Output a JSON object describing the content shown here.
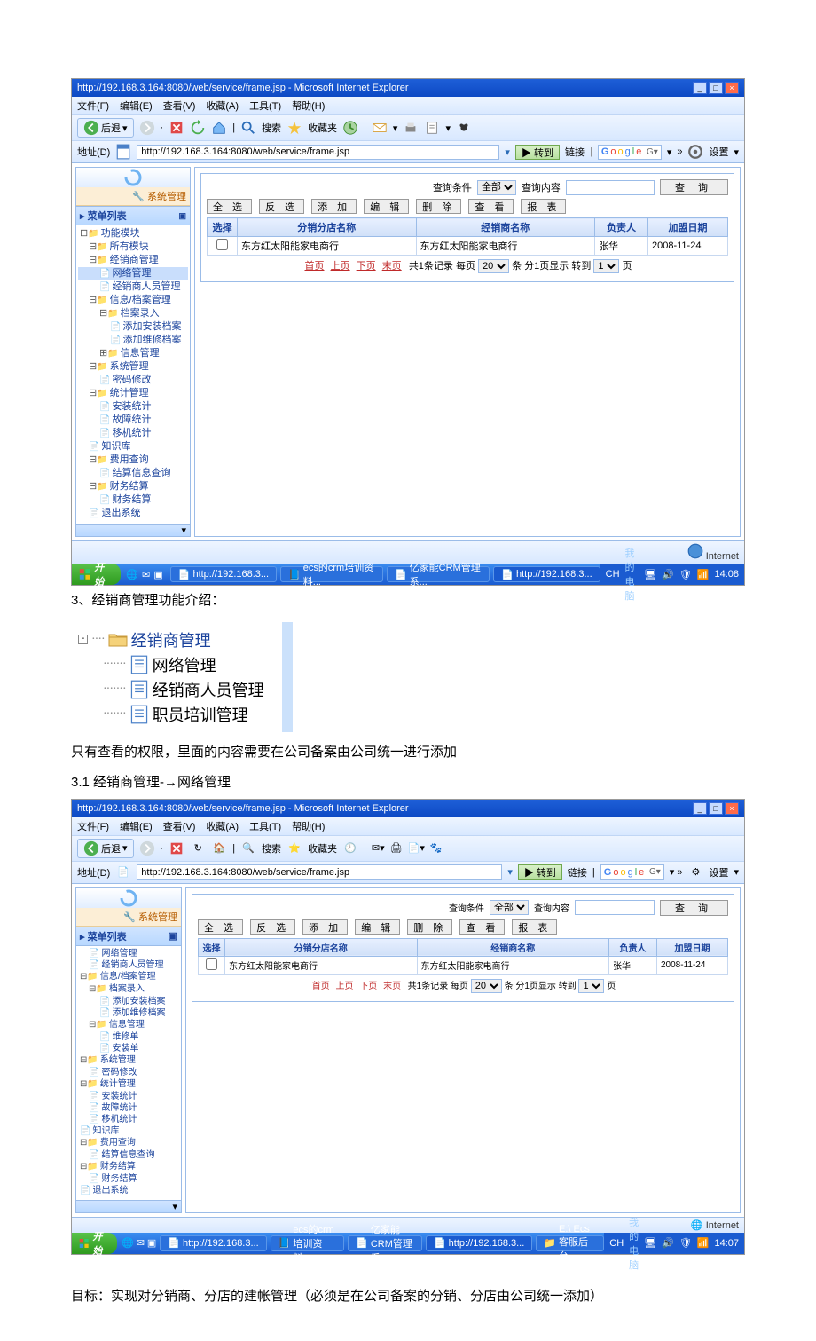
{
  "ie": {
    "title": "http://192.168.3.164:8080/web/service/frame.jsp - Microsoft Internet Explorer",
    "menus": [
      "文件(F)",
      "编辑(E)",
      "查看(V)",
      "收藏(A)",
      "工具(T)",
      "帮助(H)"
    ],
    "back": "后退",
    "search": "搜索",
    "fav": "收藏夹",
    "addr_label": "地址(D)",
    "addr": "http://192.168.3.164:8080/web/service/frame.jsp",
    "go": "转到",
    "links": "链接",
    "google": "Google",
    "settings": "设置",
    "status": "Internet"
  },
  "sidebar": {
    "brand": "系统管理",
    "list_head": "菜单列表",
    "root": "功能模块",
    "all": "所有模块",
    "items": [
      {
        "t": "经销商管理",
        "c": [
          {
            "t": "网络管理",
            "sel": true
          },
          {
            "t": "经销商人员管理"
          }
        ]
      },
      {
        "t": "信息/档案管理",
        "c": [
          {
            "t": "档案录入",
            "c": [
              {
                "t": "添加安装档案"
              },
              {
                "t": "添加维修档案"
              }
            ]
          },
          {
            "t": "信息管理"
          }
        ]
      },
      {
        "t": "系统管理",
        "c": [
          {
            "t": "密码修改"
          }
        ]
      },
      {
        "t": "统计管理",
        "c": [
          {
            "t": "安装统计"
          },
          {
            "t": "故障统计"
          },
          {
            "t": "移机统计"
          }
        ]
      },
      {
        "t": "知识库"
      },
      {
        "t": "费用查询",
        "c": [
          {
            "t": "结算信息查询"
          }
        ]
      },
      {
        "t": "财务结算",
        "c": [
          {
            "t": "财务结算"
          }
        ]
      },
      {
        "t": "退出系统"
      }
    ],
    "items2": [
      {
        "t": "网络管理"
      },
      {
        "t": "经销商人员管理"
      },
      {
        "t": "信息/档案管理",
        "c": [
          {
            "t": "档案录入",
            "c": [
              {
                "t": "添加安装档案"
              },
              {
                "t": "添加维修档案"
              }
            ]
          },
          {
            "t": "信息管理",
            "c": [
              {
                "t": "维修单"
              },
              {
                "t": "安装单"
              }
            ]
          }
        ]
      },
      {
        "t": "系统管理",
        "c": [
          {
            "t": "密码修改"
          }
        ]
      },
      {
        "t": "统计管理",
        "c": [
          {
            "t": "安装统计"
          },
          {
            "t": "故障统计"
          },
          {
            "t": "移机统计"
          }
        ]
      },
      {
        "t": "知识库"
      },
      {
        "t": "费用查询",
        "c": [
          {
            "t": "结算信息查询"
          }
        ]
      },
      {
        "t": "财务结算",
        "c": [
          {
            "t": "财务结算"
          }
        ]
      },
      {
        "t": "退出系统"
      }
    ]
  },
  "panel": {
    "q_label": "查询条件",
    "q_all": "全部",
    "q_content": "查询内容",
    "q_btn": "查  询",
    "actions": [
      "全 选",
      "反 选",
      "添 加",
      "编 辑",
      "删 除",
      "查 看",
      "报 表"
    ],
    "cols": [
      "选择",
      "分销分店名称",
      "经销商名称",
      "负责人",
      "加盟日期"
    ],
    "row": {
      "branch": "东方红太阳能家电商行",
      "dealer": "东方红太阳能家电商行",
      "owner": "张华",
      "date": "2008-11-24"
    },
    "pager": {
      "first": "首页",
      "prev": "上页",
      "next": "下页",
      "last": "末页",
      "mid1": "共1条记录 每页",
      "per": "20",
      "mid2": "条 分1页显示 转到",
      "page": "1",
      "mid3": "页"
    }
  },
  "taskbar": {
    "start": "开始",
    "items": [
      "http://192.168.3...",
      "ecs的crm培训资料...",
      "亿家能CRM管理系...",
      "http://192.168.3..."
    ],
    "items2": [
      "http://192.168.3...",
      "ecs的crm培训资料...",
      "亿家能CRM管理系...",
      "http://192.168.3...",
      "E:\\ Ecs客服后台..."
    ],
    "lang": "CH",
    "mypc": "我的电脑",
    "time": "14:08",
    "time2": "14:07"
  },
  "doc": {
    "sec3": "3、经销商管理功能介绍：",
    "tree_root": "经销商管理",
    "tree_items": [
      "网络管理",
      "经销商人员管理",
      "职员培训管理"
    ],
    "note": "只有查看的权限，里面的内容需要在公司备案由公司统一进行添加",
    "sec31": "3.1 经销商管理-→网络管理",
    "goal": "目标：实现对分销商、分店的建帐管理（必须是在公司备案的分销、分店由公司统一添加）"
  }
}
